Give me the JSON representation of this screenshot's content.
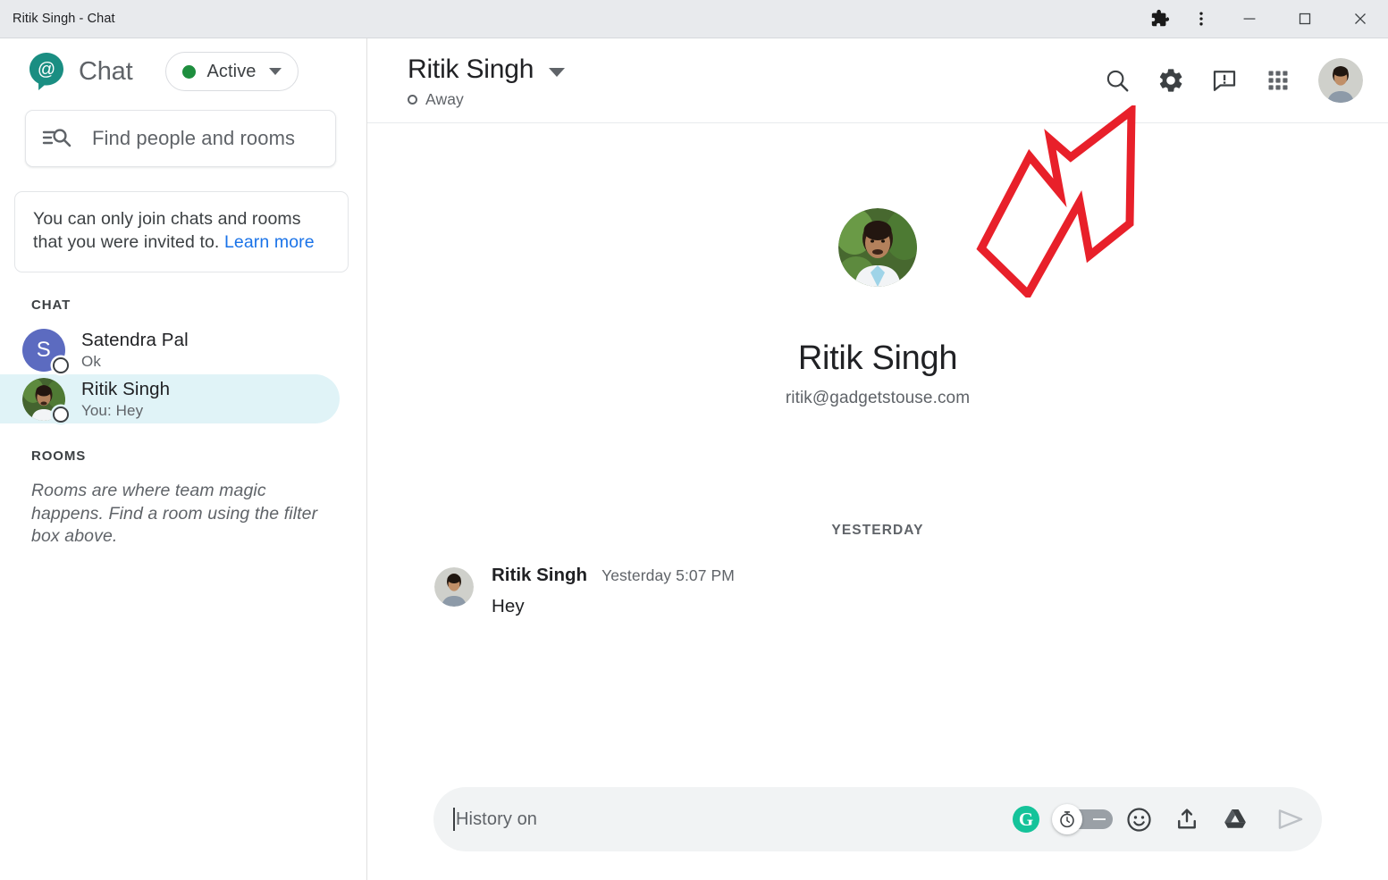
{
  "window": {
    "title": "Ritik Singh - Chat",
    "controls": {
      "extensions": "puzzle-piece-icon",
      "menu": "three-dot-menu-icon",
      "minimize": "minimize-icon",
      "maximize": "maximize-icon",
      "close": "close-icon"
    }
  },
  "sidebar": {
    "brand": {
      "logo": "chat-at-bubble-icon",
      "name": "Chat"
    },
    "status": {
      "label": "Active",
      "dot_color": "#1e8e3e",
      "caret": "chevron-down-icon"
    },
    "search": {
      "placeholder": "Find people and rooms",
      "icon": "filter-search-icon"
    },
    "notice": {
      "text": "You can only join chats and rooms that you were invited to. ",
      "link": "Learn more"
    },
    "chat_section": {
      "label": "CHAT"
    },
    "conversations": [
      {
        "name": "Satendra Pal",
        "snippet": "Ok",
        "avatar_type": "initial",
        "initial": "S",
        "avatar_color": "#5c6bc0",
        "presence": "away",
        "selected": false
      },
      {
        "name": "Ritik Singh",
        "snippet": "You: Hey",
        "avatar_type": "photo",
        "presence": "away",
        "selected": true
      }
    ],
    "rooms_section": {
      "label": "ROOMS",
      "empty_text": "Rooms are where team magic happens. Find a room using the filter box above."
    }
  },
  "main": {
    "header": {
      "title": "Ritik Singh",
      "caret": "chevron-down-icon",
      "status": "Away",
      "actions": [
        {
          "name": "search-icon"
        },
        {
          "name": "gear-icon"
        },
        {
          "name": "feedback-icon"
        },
        {
          "name": "apps-grid-icon"
        },
        {
          "name": "account-avatar"
        }
      ]
    },
    "profile": {
      "name": "Ritik Singh",
      "email": "ritik@gadgetstouse.com"
    },
    "day_divider": "YESTERDAY",
    "messages": [
      {
        "author": "Ritik Singh",
        "time": "Yesterday 5:07 PM",
        "text": "Hey"
      }
    ],
    "composer": {
      "value": "History on",
      "tools": [
        {
          "name": "grammarly-icon",
          "glyph": "G"
        },
        {
          "name": "history-toggle"
        },
        {
          "name": "emoji-icon"
        },
        {
          "name": "upload-icon"
        },
        {
          "name": "google-drive-icon"
        },
        {
          "name": "send-icon"
        }
      ]
    }
  },
  "annotation": {
    "arrow_color": "#e8202a",
    "points_to": "gear-icon"
  }
}
